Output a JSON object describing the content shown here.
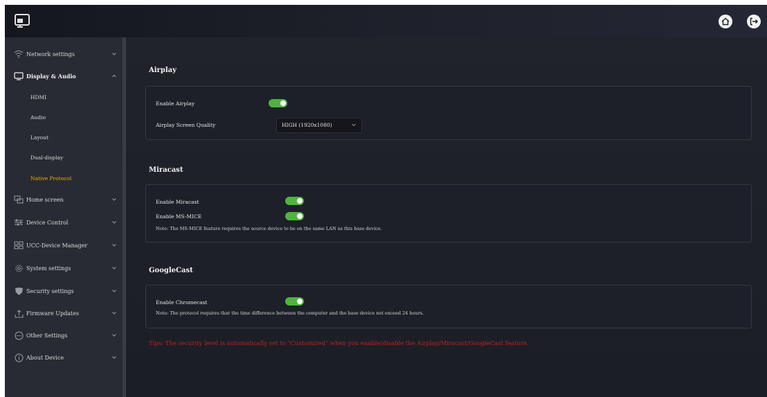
{
  "header": {
    "logo_icon": "screen-cast-icon",
    "home_icon": "home-icon",
    "logout_icon": "logout-icon"
  },
  "sidebar": {
    "items": [
      {
        "label": "Network settings",
        "icon": "wifi-icon",
        "expanded": false
      },
      {
        "label": "Display & Audio",
        "icon": "monitor-icon",
        "expanded": true,
        "children": [
          "HDMI",
          "Audio",
          "Layout",
          "Dual-display",
          "Native Protocol"
        ],
        "active_child": "Native Protocol"
      },
      {
        "label": "Home screen",
        "icon": "windows-icon",
        "expanded": false
      },
      {
        "label": "Device Control",
        "icon": "sliders-icon",
        "expanded": false
      },
      {
        "label": "UCC-Device Manager",
        "icon": "devices-icon",
        "expanded": false
      },
      {
        "label": "System settings",
        "icon": "gear-icon",
        "expanded": false
      },
      {
        "label": "Security settings",
        "icon": "shield-icon",
        "expanded": false
      },
      {
        "label": "Firmware Updates",
        "icon": "upload-icon",
        "expanded": false
      },
      {
        "label": "Other Settings",
        "icon": "more-icon",
        "expanded": false
      },
      {
        "label": "About Device",
        "icon": "info-icon",
        "expanded": false
      }
    ]
  },
  "main": {
    "airplay": {
      "title": "Airplay",
      "enable_label": "Enable Airplay",
      "enable_value": true,
      "quality_label": "Airplay Screen Quality",
      "quality_value": "HIGH (1920x1080)"
    },
    "miracast": {
      "title": "Miracast",
      "enable_label": "Enable Miracast",
      "enable_value": true,
      "msmice_label": "Enable MS-MICE",
      "msmice_value": true,
      "note": "Note: The MS-MICE feature requires the source device to be on the same LAN as this base device."
    },
    "googlecast": {
      "title": "GoogleCast",
      "enable_label": "Enable Chromecast",
      "enable_value": true,
      "note": "Note: The protocol requires that the time difference between the computer and the base device not exceed 24 hours."
    },
    "tips": "Tips:  The security level is automatically set to \"Customized\" when you enable/disable the Airplay/Miracast/GoogleCast feature."
  },
  "colors": {
    "toggle_on": "#4fb33f",
    "active_item": "#f0b400",
    "tips": "#cc1f1f"
  }
}
